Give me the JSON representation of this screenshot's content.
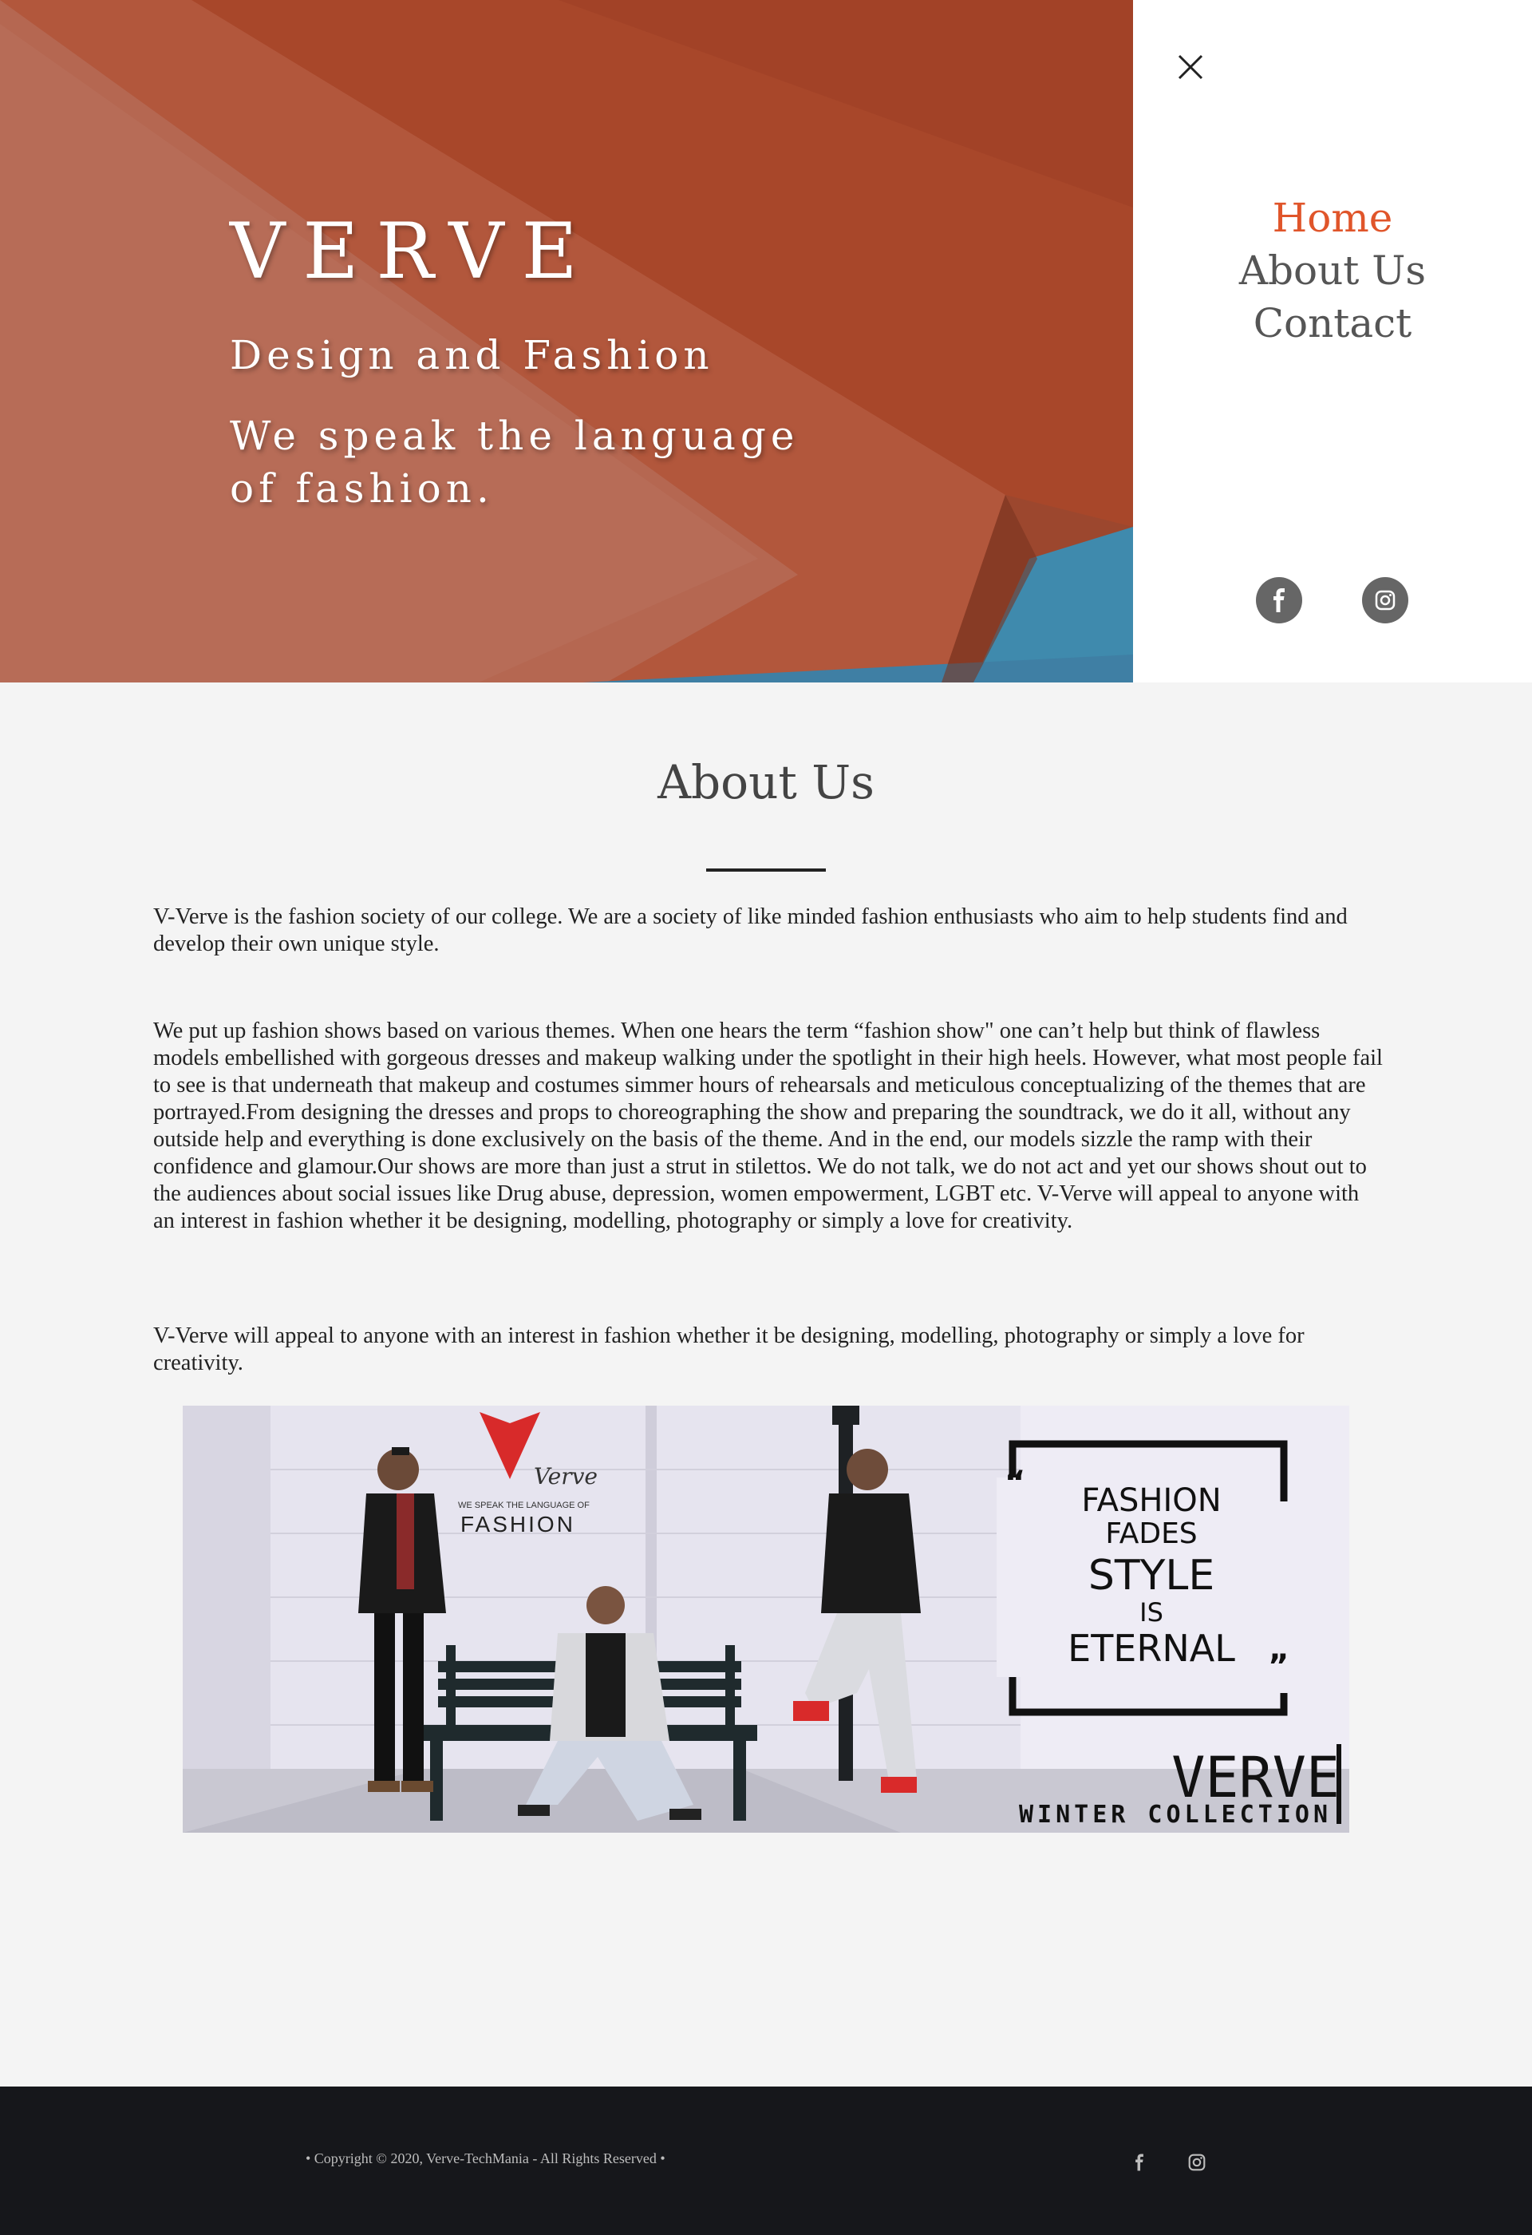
{
  "hero": {
    "brand": "VERVE",
    "tagline": "Design and Fashion",
    "slogan": "We speak the language of fashion."
  },
  "nav": {
    "items": [
      {
        "label": "Home",
        "active": true
      },
      {
        "label": "About Us",
        "active": false
      },
      {
        "label": "Contact",
        "active": false
      }
    ],
    "close_icon": "close-icon",
    "social": [
      "facebook-icon",
      "instagram-icon"
    ]
  },
  "about": {
    "title": "About Us",
    "paragraphs": [
      "V-Verve is the fashion society of our college. We are a society of like minded fashion enthusiasts who aim to help students find and develop their own unique style.",
      "We put up fashion shows based on various themes. When one hears the term “fashion show\" one can’t help but think of flawless models embellished with gorgeous dresses and makeup walking under the spotlight in their high heels. However, what most people fail to see is that underneath that makeup and costumes simmer hours of rehearsals and meticulous conceptualizing of the themes that are portrayed.From designing the dresses and props to choreographing the show and preparing the soundtrack, we do it all, without any outside help and everything is done exclusively on the basis of the theme. And in the end, our models sizzle the ramp with their confidence and glamour.Our shows are more than just a strut in stilettos. We do not talk, we do not act and yet our shows shout out to the audiences about social issues like Drug abuse, depression, women empowerment, LGBT etc. V-Verve will appeal to anyone with an interest in fashion whether it be designing, modelling, photography or simply a love for creativity.",
      "V-Verve will appeal to anyone with an interest in fashion whether it be designing, modelling, photography or simply a love for creativity."
    ]
  },
  "banner": {
    "logo_script": "Verve",
    "logo_tag": "WE SPEAK THE LANGUAGE OF",
    "logo_word": "FASHION",
    "quote_lines": [
      "FASHION",
      "FADES",
      "STYLE",
      "IS",
      "ETERNAL"
    ],
    "brand": "VERVE",
    "collection": "WINTER COLLECTION"
  },
  "footer": {
    "copyright": "• Copyright © 2020, Verve-TechMania - All Rights Reserved •"
  },
  "colors": {
    "hero_orange": "#a84a2e",
    "accent": "#e0552a",
    "hero_blue": "#3f8aad",
    "footer_bg": "#16171b"
  }
}
